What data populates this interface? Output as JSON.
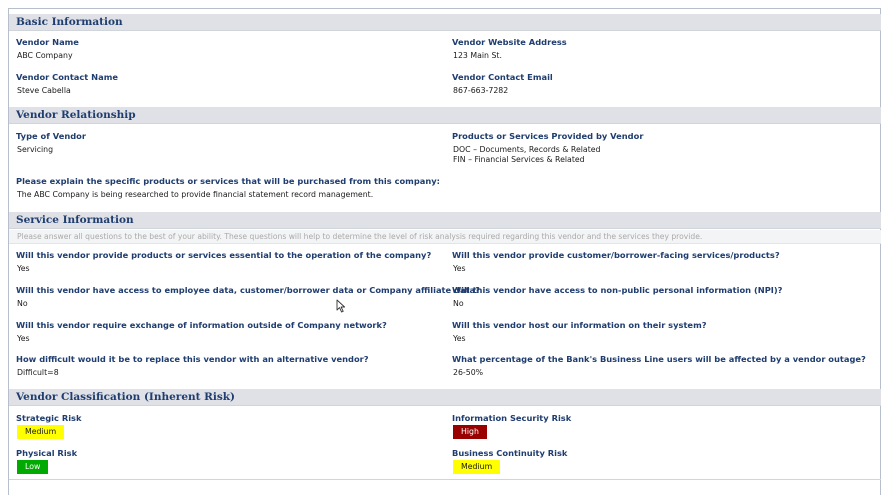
{
  "basic": {
    "heading": "Basic Information",
    "vendor_name_label": "Vendor Name",
    "vendor_name": "ABC Company",
    "website_label": "Vendor Website Address",
    "website": "123 Main St.",
    "contact_name_label": "Vendor Contact Name",
    "contact_name": "Steve Cabella",
    "contact_email_label": "Vendor Contact Email",
    "contact_email": "867-663-7282"
  },
  "relationship": {
    "heading": "Vendor Relationship",
    "type_label": "Type of Vendor",
    "type": "Servicing",
    "products_label": "Products or Services Provided by Vendor",
    "products": [
      "DOC – Documents, Records & Related",
      "FIN – Financial Services & Related"
    ],
    "explain_label": "Please explain the specific products or services that will be purchased from this company:",
    "explain": "The ABC Company is being researched to provide financial statement record management."
  },
  "service": {
    "heading": "Service Information",
    "instructions": "Please answer all questions to the best of your ability. These questions will help to determine the level of risk analysis required regarding this vendor and the services they provide.",
    "questions": [
      {
        "q": "Will this vendor provide products or services essential to the operation of the company?",
        "a": "Yes"
      },
      {
        "q": "Will this vendor provide customer/borrower-facing services/products?",
        "a": "Yes"
      },
      {
        "q": "Will this vendor have access to employee data, customer/borrower data or Company affiliate data?",
        "a": "No"
      },
      {
        "q": "Will this vendor have access to non-public personal information (NPI)?",
        "a": "No"
      },
      {
        "q": "Will this vendor require exchange of information outside of Company network?",
        "a": "Yes"
      },
      {
        "q": "Will this vendor host our information on their system?",
        "a": "Yes"
      },
      {
        "q": "How difficult would it be to replace this vendor with an alternative vendor?",
        "a": "Difficult=8"
      },
      {
        "q": "What percentage of the Bank's Business Line users will be affected by a vendor outage?",
        "a": "26-50%"
      }
    ]
  },
  "classification": {
    "heading": "Vendor Classification (Inherent Risk)",
    "risks": [
      {
        "label": "Strategic Risk",
        "level": "Medium",
        "color": "#ffff00",
        "text_color": "#1a1a1a"
      },
      {
        "label": "Information Security Risk",
        "level": "High",
        "color": "#990000",
        "text_color": "#ffffff"
      },
      {
        "label": "Physical Risk",
        "level": "Low",
        "color": "#00aa00",
        "text_color": "#ffffff"
      },
      {
        "label": "Business Continuity Risk",
        "level": "Medium",
        "color": "#ffff00",
        "text_color": "#1a1a1a"
      }
    ]
  }
}
